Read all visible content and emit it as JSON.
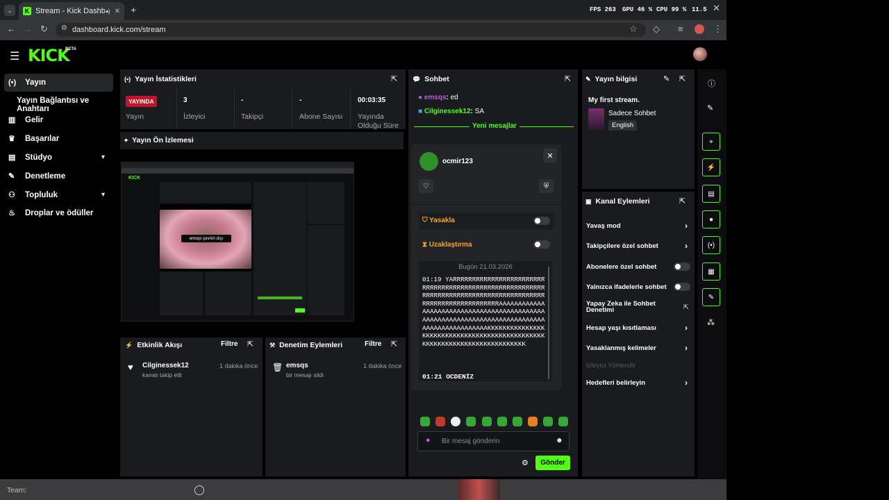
{
  "browser": {
    "tab_title": "Stream - Kick Dashboard",
    "url": "dashboard.kick.com/stream",
    "overlay": {
      "fps": "FPS 263",
      "gpu": "GPU 46 %",
      "cpu": "CPU 99 %",
      "temp": "11.5"
    }
  },
  "brand": {
    "logo": "KICK",
    "badge": "BETA",
    "accent": "#53fc18"
  },
  "nav": {
    "items": [
      {
        "label": "Yayın",
        "icon": "broadcast-icon"
      },
      {
        "label": "Yayın Bağlantısı ve Anahtarı"
      },
      {
        "label": "Gelir",
        "icon": "chart-icon"
      },
      {
        "label": "Başarılar",
        "icon": "trophy-icon"
      },
      {
        "label": "Stüdyo",
        "icon": "studio-icon"
      },
      {
        "label": "Denetleme",
        "icon": "wrench-icon"
      },
      {
        "label": "Topluluk",
        "icon": "community-icon"
      },
      {
        "label": "Droplar ve ödüller",
        "icon": "gift-icon"
      }
    ]
  },
  "stats": {
    "title": "Yayın İstatistikleri",
    "live_badge": "YAYINDA",
    "items": [
      {
        "value": "",
        "label": "Yayın"
      },
      {
        "value": "3",
        "label": "İzleyici"
      },
      {
        "value": "-",
        "label": "Takipçi"
      },
      {
        "value": "-",
        "label": "Abone Sayısı"
      },
      {
        "value": "00:03:35",
        "label": "Yayında Olduğu Süre"
      }
    ]
  },
  "preview": {
    "title": "Yayın Ön İzlemesi",
    "caption": "emsqs çevrim dışı"
  },
  "activity": {
    "title": "Etkinlik Akışı",
    "filter": "Filtre",
    "user": "Cilginessek12",
    "action": "kanalı takip etti",
    "time": "1 dakika önce"
  },
  "moderation": {
    "title": "Denetim Eylemleri",
    "filter": "Filtre",
    "user": "emsqs",
    "action": "bir mesajı sildi",
    "time": "1 dakika önce"
  },
  "chat": {
    "title": "Sohbet",
    "messages": [
      {
        "user": "emsqs",
        "text": "ed"
      },
      {
        "user": "Cilginessek12",
        "text": "SA"
      }
    ],
    "new_messages": "Yeni mesajlar",
    "placeholder": "Bir mesaj gönderin",
    "send": "Gönder"
  },
  "usercard": {
    "username": "ocmir123",
    "ban": "Yasakla",
    "timeout": "Uzaklaştırma",
    "date": "Bugün 21.03.2026",
    "log": [
      {
        "time": "01:19",
        "text": "YARRRRRRRRRRRRRRRRRRRRRRRRRRRRRRRRRRRRRRRRRRRRRRRRRRRRRRRRRRRRRRRRRRRRRRRRRRRRRRRRRRRRRRRRRRRRRRRRRRRRRRRRRRRRAAAAAAAAAAAAAAAAAAAAAAAAAAAAAAAAAAAAAAAAAAAAAAAAAAAAAAAAAAAAAAAAAAAAAAAAAAAAAAAAAAAAAAAAAAAAAKKKKKKKKKKKKKKKKKKKKKKKKKKKKKKKKKKKKKKKKKKKKKKKKKKKKKKKKKKKKKKKKKKKKKKKKKK"
      },
      {
        "time": "01:21",
        "text": "OCDENİZ"
      }
    ]
  },
  "streaminfo": {
    "title": "Yayın bilgisi",
    "stream_title": "My first stream.",
    "category": "Sadece Sohbet",
    "language": "English"
  },
  "channel_actions": {
    "title": "Kanal Eylemleri",
    "items": [
      {
        "label": "Yavaş mod",
        "kind": "arrow"
      },
      {
        "label": "Takipçilere özel sohbet",
        "kind": "arrow"
      },
      {
        "label": "Abonelere özel sohbet",
        "kind": "toggle"
      },
      {
        "label": "Yalnızca ifadelerle sohbet",
        "kind": "toggle"
      },
      {
        "label": "Yapay Zeka ile Sohbet Denetimi",
        "kind": "external"
      },
      {
        "label": "Hesap yaşı kısıtlaması",
        "kind": "arrow"
      },
      {
        "label": "Yasaklanmış kelimeler",
        "kind": "arrow"
      },
      {
        "label": "İzleyici Yönlendir",
        "kind": "disabled"
      },
      {
        "label": "Hedefleri belirleyin",
        "kind": "arrow"
      }
    ]
  },
  "taskbar": {
    "text": "Team:"
  }
}
